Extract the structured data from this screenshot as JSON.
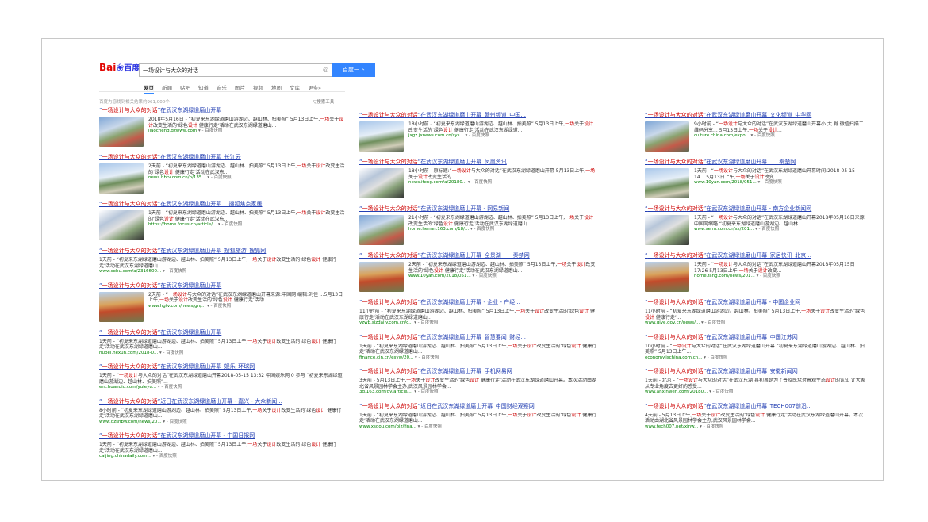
{
  "header": {
    "logo_text": "Bai",
    "logo_paw": "du",
    "logo_cn": "百度",
    "query": "一场设计与大众的对话",
    "search_button": "百度一下",
    "tabs": [
      "网页",
      "新闻",
      "贴吧",
      "知道",
      "音乐",
      "图片",
      "视频",
      "地图",
      "文库",
      "更多»"
    ],
    "result_count": "百度为您找到相关结果约961,000个",
    "search_tools": "搜索工具"
  },
  "results": [
    {
      "col": 1,
      "title_pre": "一场设计与大众的对话",
      "title_post": "在武汉东湖绿道磨山开幕",
      "img": "a",
      "text": "2018年5月16日 - “初夏来东湖绿道磨山游湖边、越山林、拍美照” 5月13日上午,一场关于设计改变生活的‘绿色设计 健康行走’活动在武汉东湖绿道磨山...",
      "url": "liaocheng.dzwww.com"
    },
    {
      "col": 1,
      "title_pre": "一场设计与大众的对话",
      "title_post": "在武汉东湖绿道磨山开幕_长江云",
      "img": "b",
      "text": "2天前 - “初夏来东湖绿道磨山游湖边、越山林、拍美照” 5月13日上午,一场关于设计改变生活的‘绿色设计 健康行走’活动在武汉东...",
      "url": "news.hbtv.com.cn/p/135..."
    },
    {
      "col": 1,
      "title_pre": "一场设计与大众的对话",
      "title_post": "在武汉东湖绿道磨山开幕_ _搜狐焦点家居",
      "img": "c",
      "text": "1天前 - “初夏来东湖绿道磨山游湖边、越山林、拍美照” 5月13日上午,一场关于设计改变生活的‘绿色设计 健康行走’活动在武汉东...",
      "url": "https://home.focus.cn/article/..."
    },
    {
      "col": 1,
      "title_pre": "一场设计与大众的对话",
      "title_post": "在武汉东湖绿道磨山开幕_搜狐旅游_搜狐网",
      "img": "",
      "text": "1天前 - “初夏来东湖绿道磨山游湖边、越山林、拍美照” 5月13日上午,一场关于设计改变生活的‘绿色设计 健康行走’活动在武汉东湖绿道磨山...",
      "url": "www.sohu.com/a/2316600..."
    },
    {
      "col": 1,
      "title_pre": "一场设计与大众的对话",
      "title_post": "在武汉东湖绿道磨山开幕",
      "img": "d",
      "text": "2天前 - “一场设计与大众的对话”在武汉东湖绿道磨山开幕来源:中国网 编辑:刘佳 ...5月13日上午,一场关于设计改变生活的‘绿色设计 健康行走’活动...",
      "url": "www.hgtv.com/news/gn/..."
    },
    {
      "col": 1,
      "title_pre": "一场设计与大众的对话",
      "title_post": "在武汉东湖绿道磨山开幕",
      "img": "",
      "text": "1天前 - “初夏来东湖绿道磨山游湖边、越山林、拍美照” 5月13日上午,一场关于设计改变生活的‘绿色设计 健康行走’活动在武汉东湖绿道磨山...",
      "url": "hubei.hexun.com/2018-0..."
    },
    {
      "col": 1,
      "title_pre": "一场设计与大众的对话",
      "title_post": "在武汉东湖绿道磨山开幕_娱乐_环球网",
      "img": "",
      "text": "1天前 - “一场设计与大众的对话”在武汉东湖绿道磨山开幕2018-05-15 13:32 中国娱乐网 0 参与 “初夏来东湖绿道磨山游湖边、越山林、拍美照”...",
      "url": "ent.huanqiu.com/yuleyu..."
    },
    {
      "col": 1,
      "title_pre": "一场设计与大众的对话",
      "title_post": "近日在武汉东湖绿道磨山开幕 - 嘉兴 - 大众新闻...",
      "img": "",
      "text": "8小时前 - “初夏来东湖绿道磨山游湖边、越山林、拍美照” 5月13日上午,一场关于设计改变生活的‘绿色设计 健康行走’活动在武汉东湖绿道磨山...",
      "url": "www.dzshbw.com/news/20..."
    },
    {
      "col": 1,
      "title_pre": "一场设计与大众的对话",
      "title_post": "在武汉东湖绿道磨山开幕 - 中国日报网",
      "img": "",
      "text": "1天前 - “初夏来东湖绿道磨山游湖边、越山林、拍美照” 5月13日上午,一场关于设计改变生活的‘绿色设计 健康行走’活动在武汉东湖绿道磨山...",
      "url": "caijing.chinadaily.com..."
    },
    {
      "col": 2,
      "title_pre": "一场设计与大众的对话",
      "title_post": "在武汉东湖绿道磨山开幕_赣州频道_中国...",
      "img": "b",
      "text": "18小时前 - “初夏来东湖绿道磨山游湖边、越山林、拍美照” 5月13日上午,一场关于设计改变生活的‘绿色设计 健康行走’活动在武汉东湖绿道...",
      "url": "jxgz.jxnews.com.cn/sys..."
    },
    {
      "col": 2,
      "title_pre": "一场设计与大众的对话",
      "title_post": "在武汉东湖绿道磨山开幕_凤凰资讯",
      "img": "c",
      "text": "18小时前 - 原标题:“一场设计与大众的对话”在武汉东湖绿道磨山开幕 5月13日上午,一场关于设计改变生活的...",
      "url": "news.ifeng.com/a/20180..."
    },
    {
      "col": 2,
      "title_pre": "一场设计与大众的对话",
      "title_post": "在武汉东湖绿道磨山开幕 - 网易新闻",
      "img": "a",
      "text": "21小时前 - “初夏来东湖绿道磨山游湖边、越山林、拍美照” 5月13日上午,一场关于设计改变生活的‘绿色设计 健康行走’活动在武汉东湖绿道磨山...",
      "url": "home.henan.163.com/18/..."
    },
    {
      "col": 2,
      "title_pre": "一场设计与大众的对话",
      "title_post": "在武汉东湖绿道磨山开幕_全景湖_ _ _秦禁网",
      "img": "d",
      "text": "2天前 - “初夏来东湖绿道磨山游湖边、越山林、拍美照” 5月13日上午,一场关于设计改变生活的‘绿色设计 健康行走’活动在武汉东湖绿道磨山...",
      "url": "www.10yan.com/2018/051..."
    },
    {
      "col": 2,
      "title_pre": "一场设计与大众的对话",
      "title_post": "在武汉东湖绿道磨山开幕 - 企业 - 产经...",
      "img": "",
      "text": "11小时前 - “初夏来东湖绿道磨山游湖边、越山林、拍美照” 5月13日上午,一场关于设计改变生活的‘绿色设计 健康行走’活动在武汉东湖绿道磨山...",
      "url": "yzwb.sjzdaily.com.cn/c..."
    },
    {
      "col": 2,
      "title_pre": "一场设计与大众的对话",
      "title_post": "在武汉东湖绿道磨山开幕_智慧要闻_财经...",
      "img": "",
      "text": "1天前 - “初夏来东湖绿道磨山游湖边、越山林、拍美照” 5月13日上午,一场关于设计改变生活的‘绿色设计 健康行走’活动在武汉东湖绿道磨山...",
      "url": "finance.cjn.cn/esyw/20..."
    },
    {
      "col": 2,
      "title_pre": "一场设计与大众的对话",
      "title_post": "在武汉东湖绿道磨山开幕_手机网易网",
      "img": "",
      "text": "3天前 - 5月13日上午,一场关于设计改变生活的‘绿色设计 健康行走’活动在武汉东湖绿道磨山开幕。本次活动由湖北省风景园林学会主办,武汉风景园林学会...",
      "url": "3g.163.com/dy/article/..."
    },
    {
      "col": 2,
      "title_pre": "一场设计与大众的对话",
      "title_post": "近日在武汉东湖绿道磨山开幕_中国财经观察网",
      "img": "",
      "text": "1天前 - “初夏来东湖绿道磨山游湖边、越山林、拍美照” 5月13日上午,一场关于设计改变生活的‘绿色设计 健康行走’活动在武汉东湖绿道磨山...",
      "url": "www.xsgou.com/biz/fina..."
    },
    {
      "col": 3,
      "title_pre": "一场设计与大众的对话",
      "title_post": "在武汉东湖绿道磨山开幕_文化频道_中华网",
      "img": "a",
      "text": "9小时前 - “一场设计与大众的对话”在武汉东湖绿道磨山开幕小 大 肖 微信扫描二维码分享... 5月13日上午,一场关于设计...",
      "url": "culture.china.com/expo..."
    },
    {
      "col": 3,
      "title_pre": "一场设计与大众的对话",
      "title_post": "在武汉东湖绿道磨山开幕_ _ _秦楚网",
      "img": "b",
      "text": "1天前 - “一场设计与大众的对话”在武汉东湖绿道磨山开幕时间:2018-05-15 14... 5月13日上午,一场关于设计改变...",
      "url": "www.10yan.com/2018/051..."
    },
    {
      "col": 3,
      "title_pre": "一场设计与大众的对话",
      "title_post": "在武汉东湖绿道磨山开幕 - 南方企业新闻网",
      "img": "c",
      "text": "1天前 - “一场设计与大众的对话”在武汉东湖绿道磨山开幕2018年05月16日来源:中国网缩略 “初夏来东湖绿道磨山游湖边、越山林...",
      "url": "www.senn.com.cn/sx/201..."
    },
    {
      "col": 3,
      "title_pre": "一场设计与大众的对话",
      "title_post": "在武汉东湖绿道磨山开幕_家居快讯_北京...",
      "img": "d",
      "text": "1天前 - “一场设计与大众的对话”在武汉东湖绿道磨山开幕2018年05月15日 17:26 5月13日上午,一场关于设计改变...",
      "url": "home.fang.com/news/201..."
    },
    {
      "col": 3,
      "title_pre": "一场设计与大众的对话",
      "title_post": "在武汉东湖绿道磨山开幕 - 中国企业网",
      "img": "",
      "text": "11小时前 - “初夏来东湖绿道磨山游湖边、越山林、拍美照” 5月13日上午,一场关于设计改变生活的‘绿色设计 健康行走’...",
      "url": "www.qiye.gov.cn/news/..."
    },
    {
      "col": 3,
      "title_pre": "一场设计与大众的对话",
      "title_post": "在武汉东湖绿道磨山开幕_中国江苏网",
      "img": "",
      "text": "10小时前 - “一场设计与大众的对话”在武汉东湖绿道磨山开幕 “初夏来东湖绿道磨山游湖边、越山林、拍美照” 5月13日上午...",
      "url": "economy.jschina.com.cn..."
    },
    {
      "col": 3,
      "title_pre": "一场设计与大众的对话",
      "title_post": "在武汉东湖绿道磨山开幕_安徽新闻网",
      "img": "",
      "text": "1天前 - 北京 - “一场设计与大众的对话”在武汉东湖 其初衷是为了普及民众对景观生态设计的认知 让大家从专业角度去更好的感受...",
      "url": "www.ahxinwen.com/20180..."
    },
    {
      "col": 3,
      "title_pre": "一场设计与大众的对话",
      "title_post": "在武汉东湖绿道磨山开幕_TECH007前沿...",
      "img": "",
      "text": "4天前 - 5月13日上午,一场关于设计改变生活的‘绿色设计 健康行走’活动在武汉东湖绿道磨山开幕。本次活动由湖北省风景园林学会主办,武汉风景园林学会...",
      "url": "www.tech007.net/xinw..."
    }
  ],
  "kuaizhao": "百度快照"
}
